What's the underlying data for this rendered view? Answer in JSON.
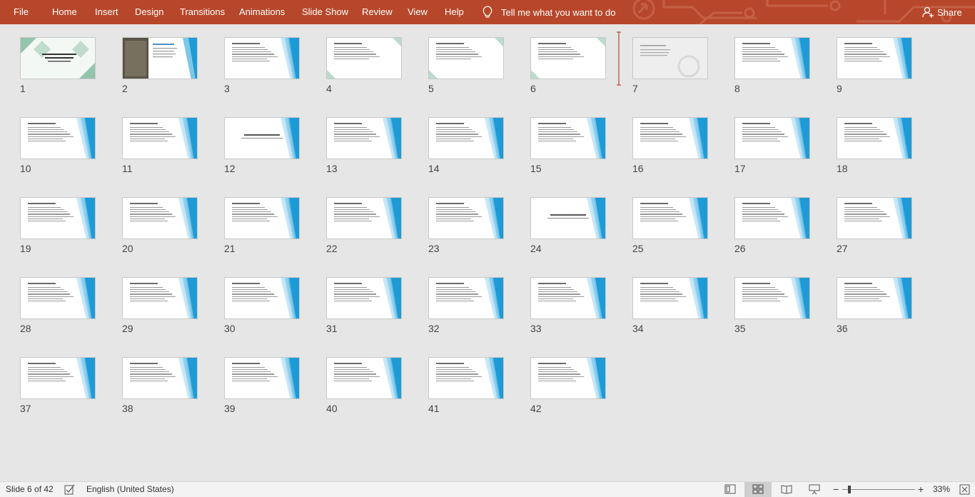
{
  "menu": {
    "tabs": [
      "File",
      "Home",
      "Insert",
      "Design",
      "Transitions",
      "Animations",
      "Slide Show",
      "Review",
      "View",
      "Help"
    ],
    "tell_me": "Tell me what you want to do",
    "share": "Share"
  },
  "colors": {
    "ribbon": "#b7472a",
    "accent_blue": "#1e9bd7",
    "background": "#e6e6e6"
  },
  "slides": [
    {
      "number": "1",
      "style": "green-title"
    },
    {
      "number": "2",
      "style": "photo"
    },
    {
      "number": "3",
      "style": "blue"
    },
    {
      "number": "4",
      "style": "green-light"
    },
    {
      "number": "5",
      "style": "green-light"
    },
    {
      "number": "6",
      "style": "green-light"
    },
    {
      "number": "7",
      "style": "grey"
    },
    {
      "number": "8",
      "style": "blue"
    },
    {
      "number": "9",
      "style": "blue"
    },
    {
      "number": "10",
      "style": "blue"
    },
    {
      "number": "11",
      "style": "blue"
    },
    {
      "number": "12",
      "style": "blue-title"
    },
    {
      "number": "13",
      "style": "blue"
    },
    {
      "number": "14",
      "style": "blue"
    },
    {
      "number": "15",
      "style": "blue"
    },
    {
      "number": "16",
      "style": "blue"
    },
    {
      "number": "17",
      "style": "blue"
    },
    {
      "number": "18",
      "style": "blue"
    },
    {
      "number": "19",
      "style": "blue"
    },
    {
      "number": "20",
      "style": "blue"
    },
    {
      "number": "21",
      "style": "blue"
    },
    {
      "number": "22",
      "style": "blue"
    },
    {
      "number": "23",
      "style": "blue"
    },
    {
      "number": "24",
      "style": "blue-title"
    },
    {
      "number": "25",
      "style": "blue"
    },
    {
      "number": "26",
      "style": "blue"
    },
    {
      "number": "27",
      "style": "blue"
    },
    {
      "number": "28",
      "style": "blue"
    },
    {
      "number": "29",
      "style": "blue"
    },
    {
      "number": "30",
      "style": "blue"
    },
    {
      "number": "31",
      "style": "blue"
    },
    {
      "number": "32",
      "style": "blue"
    },
    {
      "number": "33",
      "style": "blue"
    },
    {
      "number": "34",
      "style": "blue"
    },
    {
      "number": "35",
      "style": "blue"
    },
    {
      "number": "36",
      "style": "blue"
    },
    {
      "number": "37",
      "style": "blue"
    },
    {
      "number": "38",
      "style": "blue"
    },
    {
      "number": "39",
      "style": "blue"
    },
    {
      "number": "40",
      "style": "blue"
    },
    {
      "number": "41",
      "style": "blue"
    },
    {
      "number": "42",
      "style": "blue"
    }
  ],
  "status": {
    "slide_counter": "Slide 6 of 42",
    "language": "English (United States)",
    "zoom": "33%",
    "zoom_out": "−",
    "zoom_in": "+"
  }
}
